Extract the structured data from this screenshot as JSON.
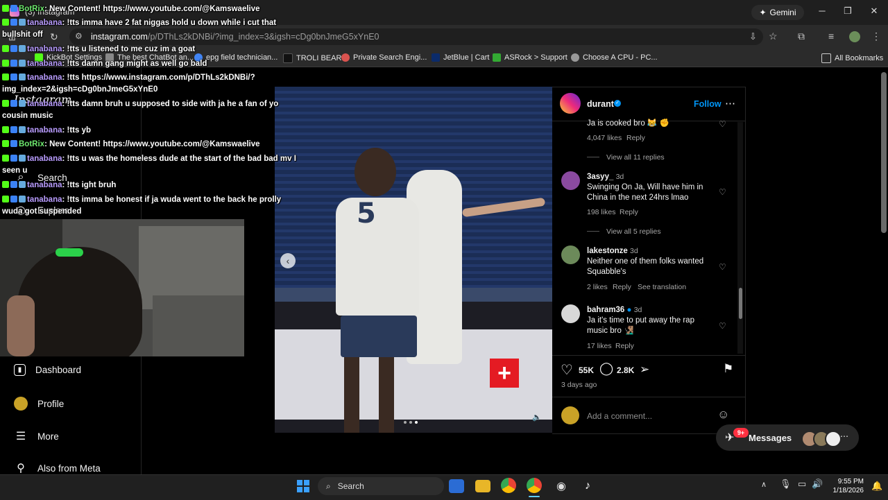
{
  "browser": {
    "tab_title": "(3) Instagram",
    "gemini_label": "Gemini",
    "url_host": "instagram.com",
    "url_path": "/p/DThLs2kDNBi/?img_index=3&igsh=cDg0bnJmeG5xYnE0",
    "bookmarks": [
      {
        "label": "KickBot Settings",
        "icon": "kick-icon",
        "color": "#53fc18"
      },
      {
        "label": "The best ChatBot an...",
        "icon": "bot-icon",
        "color": "#888888"
      },
      {
        "label": "epg field technician...",
        "icon": "google-icon",
        "color": "#4285f4"
      },
      {
        "label": "TROLI BEAR",
        "icon": "t-icon",
        "color": "#111111"
      },
      {
        "label": "Private Search Engi...",
        "icon": "privacy-icon",
        "color": "#d9534f"
      },
      {
        "label": "JetBlue | Cart",
        "icon": "jetblue-icon",
        "color": "#0b2b6a"
      },
      {
        "label": "ASRock > Support",
        "icon": "asrock-icon",
        "color": "#33aa33"
      },
      {
        "label": "Choose A CPU - PC...",
        "icon": "cpu-icon",
        "color": "#999999"
      }
    ],
    "all_bookmarks": "All Bookmarks"
  },
  "instagram": {
    "logo_text": "Instagram",
    "nav": [
      {
        "label": "Search",
        "icon": "search-icon"
      },
      {
        "label": "Explore",
        "icon": "compass-icon"
      },
      {
        "label": "Dashboard",
        "icon": "dashboard-icon"
      },
      {
        "label": "Profile",
        "icon": "avatar-icon"
      },
      {
        "label": "More",
        "icon": "menu-icon"
      },
      {
        "label": "Also from Meta",
        "icon": "meta-icon"
      }
    ],
    "post": {
      "username": "durant",
      "follow": "Follow",
      "jersey_number": "5",
      "likes": "55K",
      "comments_count": "2.8K",
      "time_ago": "3 days ago",
      "add_comment_placeholder": "Add a comment...",
      "comments": [
        {
          "text": "Ja is cooked bro 😹 ✊",
          "likes": "4,047 likes",
          "reply": "Reply",
          "view_replies": "View all 11 replies"
        },
        {
          "user": "3asyy_",
          "time": "3d",
          "text": "Swinging On Ja, Will have him in China in the next 24hrs lmao",
          "likes": "198 likes",
          "reply": "Reply",
          "view_replies": "View all 5 replies"
        },
        {
          "user": "lakestonze",
          "time": "3d",
          "text": "Neither one of them folks wanted Squabble's",
          "likes": "2 likes",
          "reply": "Reply",
          "see_translation": "See translation"
        },
        {
          "user": "bahram36",
          "time": "3d",
          "text": "Ja it's time to put away the rap music bro 🧏🏽‍♂️",
          "likes": "17 likes",
          "reply": "Reply"
        }
      ]
    },
    "messages_label": "Messages",
    "messages_badge": "9+"
  },
  "chat": [
    {
      "user": "BotRix",
      "msg": ": New Content! https://www.youtube.com/@Kamswaelive",
      "bot": true
    },
    {
      "user": "tanabana",
      "msg": ": !tts imma have 2 fat niggas hold u down while i cut that",
      "cont": "bullshit off"
    },
    {
      "user": "tanabana",
      "msg": ": !tts u listened to me cuz im a goat"
    },
    {
      "user": "tanabana",
      "msg": ": !tts damn gang might as well go bald"
    },
    {
      "user": "tanabana",
      "msg": ": !tts https://www.instagram.com/p/DThLs2kDNBi/?",
      "cont": "img_index=2&igsh=cDg0bnJmeG5xYnE0"
    },
    {
      "user": "tanabana",
      "msg": ": !tts damn bruh u supposed to side with ja he a fan of yo",
      "cont": "cousin music"
    },
    {
      "user": "tanabana",
      "msg": ": !tts yb"
    },
    {
      "user": "BotRix",
      "msg": ": New Content! https://www.youtube.com/@Kamswaelive",
      "bot": true
    },
    {
      "user": "tanabana",
      "msg": ": !tts u was the homeless dude at the start of the bad bad mv I",
      "cont": "seen u"
    },
    {
      "user": "tanabana",
      "msg": ": !tts ight bruh"
    },
    {
      "user": "tanabana",
      "msg": ": !tts imma be honest if ja wuda went to the back he prolly",
      "cont": "wuda got suspended"
    }
  ],
  "taskbar": {
    "search_label": "Search",
    "time": "9:55 PM",
    "date": "1/18/2026"
  },
  "colors": {
    "instagram_blue": "#0095f6",
    "chat_user": "#b99cff",
    "chat_bot": "#6ee86e",
    "notification_red": "#ff3040"
  }
}
